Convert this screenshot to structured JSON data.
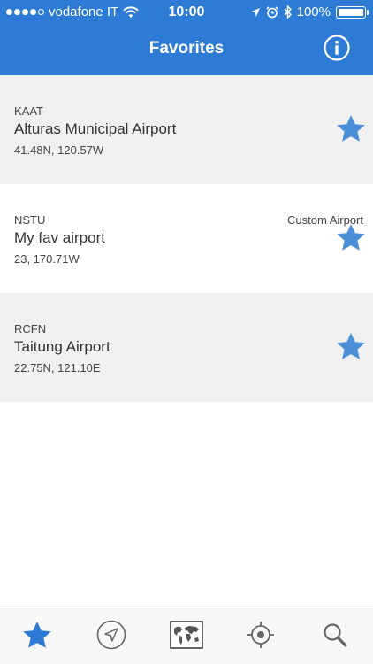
{
  "status_bar": {
    "carrier": "vodafone IT",
    "time": "10:00",
    "battery": "100%"
  },
  "header": {
    "title": "Favorites"
  },
  "favorites": [
    {
      "code": "KAAT",
      "name": "Alturas Municipal Airport",
      "coords": "41.48N, 120.57W",
      "tag": ""
    },
    {
      "code": "NSTU",
      "name": "My fav airport",
      "coords": "23, 170.71W",
      "tag": "Custom Airport"
    },
    {
      "code": "RCFN",
      "name": "Taitung Airport",
      "coords": "22.75N, 121.10E",
      "tag": ""
    }
  ],
  "tabbar": {
    "tabs": [
      "favorites-star-icon",
      "navigation-arrow-icon",
      "world-map-icon",
      "crosshair-location-icon",
      "search-icon"
    ],
    "active": 0
  },
  "colors": {
    "accent": "#2e7bd5",
    "star": "#4a8fd8",
    "row_grey": "#f0f0f0"
  }
}
